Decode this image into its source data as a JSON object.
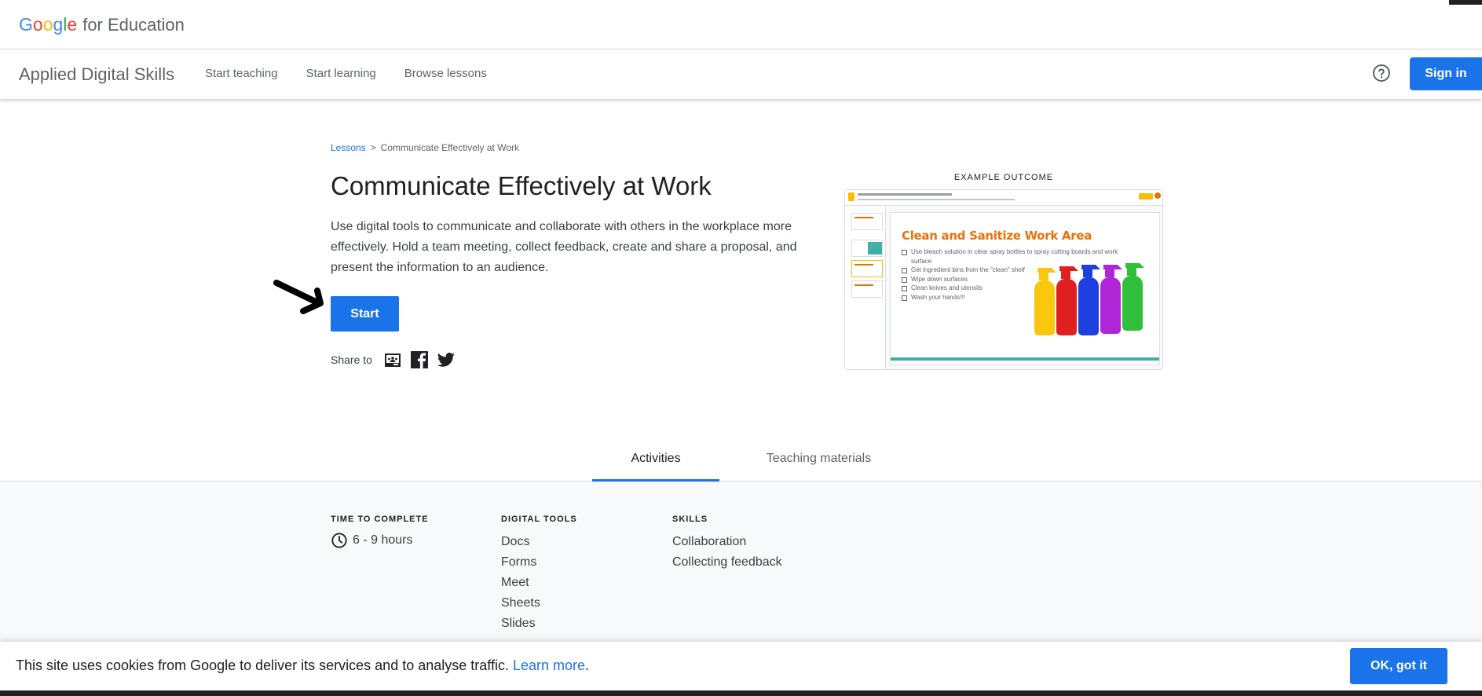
{
  "header": {
    "logo_letters": [
      "G",
      "o",
      "o",
      "g",
      "l",
      "e"
    ],
    "logo_suffix": "for Education"
  },
  "nav": {
    "brand": "Applied Digital Skills",
    "links": [
      "Start teaching",
      "Start learning",
      "Browse lessons"
    ],
    "help_icon": "help-circle-icon",
    "sign_in": "Sign in"
  },
  "breadcrumb": {
    "root": "Lessons",
    "separator": ">",
    "current": "Communicate Effectively at Work"
  },
  "lesson": {
    "title": "Communicate Effectively at Work",
    "description": "Use digital tools to communicate and collaborate with others in the workplace more effectively. Hold a team meeting, collect feedback, create and share a proposal, and present the information to an audience.",
    "start_label": "Start",
    "share_label": "Share to",
    "share_icons": [
      "google-classroom-icon",
      "facebook-icon",
      "twitter-icon"
    ]
  },
  "outcome": {
    "label": "EXAMPLE OUTCOME",
    "slide_title": "Clean and Sanitize Work Area",
    "slide_items": [
      "Use bleach solution in clear spray bottles to spray cutting boards and work surface",
      "Get ingredient bins from the \"clean\" shelf",
      "Wipe down surfaces",
      "Clean knives and utensils",
      "Wash your hands!!!"
    ]
  },
  "tabs": {
    "activities": "Activities",
    "materials": "Teaching materials",
    "active": "Activities"
  },
  "details": {
    "time": {
      "heading": "TIME TO COMPLETE",
      "value": "6 - 9 hours"
    },
    "tools": {
      "heading": "DIGITAL TOOLS",
      "items": [
        "Docs",
        "Forms",
        "Meet",
        "Sheets",
        "Slides"
      ]
    },
    "skills": {
      "heading": "SKILLS",
      "items": [
        "Collaboration",
        "Collecting feedback"
      ]
    }
  },
  "cookie": {
    "text": "This site uses cookies from Google to deliver its services and to analyse traffic.",
    "link": "Learn more",
    "suffix": ".",
    "ok": "OK, got it"
  },
  "colors": {
    "accent": "#1a73e8",
    "slide_title": "#e8710a",
    "slide_bar": "#3fb0a5"
  }
}
